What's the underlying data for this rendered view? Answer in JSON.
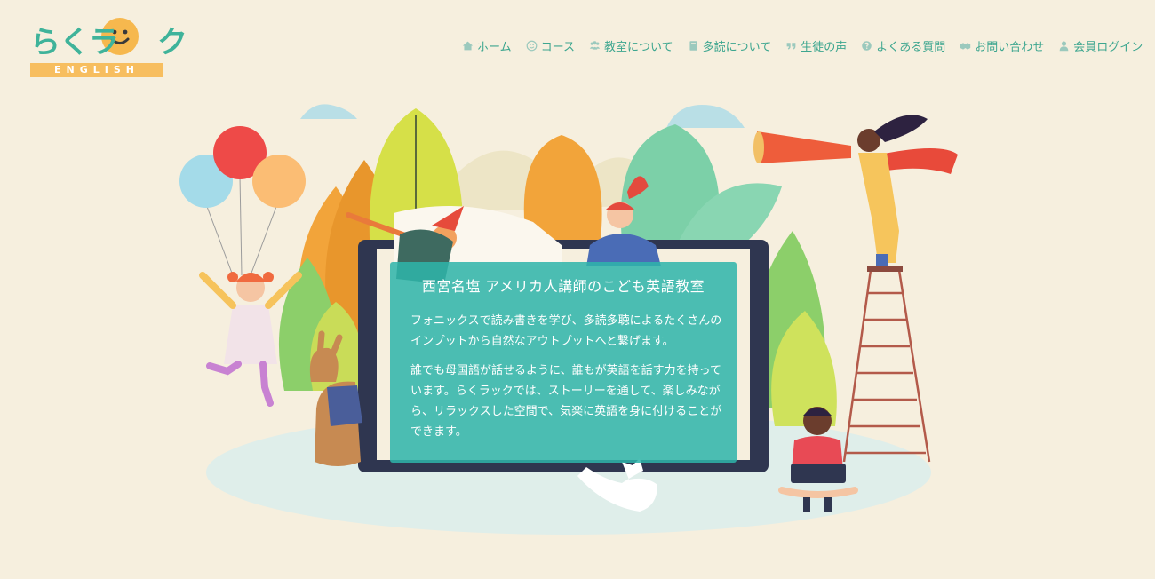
{
  "logo": {
    "text": "らくラ",
    "text_end": "ク",
    "sub": "ENGLISH"
  },
  "nav": {
    "items": [
      {
        "label": "ホーム",
        "icon": "home-icon",
        "active": true
      },
      {
        "label": "コース",
        "icon": "smile-icon"
      },
      {
        "label": "教室について",
        "icon": "people-icon"
      },
      {
        "label": "多読について",
        "icon": "book-icon"
      },
      {
        "label": "生徒の声",
        "icon": "quote-icon"
      },
      {
        "label": "よくある質問",
        "icon": "question-icon"
      },
      {
        "label": "お問い合わせ",
        "icon": "handshake-icon"
      },
      {
        "label": "会員ログイン",
        "icon": "user-icon"
      }
    ]
  },
  "hero": {
    "title": "西宮名塩 アメリカ人講師のこども英語教室",
    "paragraph1": "フォニックスで読み書きを学び、多読多聴によるたくさんのインプットから自然なアウトプットへと繋げます。",
    "paragraph2": "誰でも母国語が話せるように、誰もが英語を話す力を持っています。らくラックでは、ストーリーを通して、楽しみながら、リラックスした空間で、気楽に英語を身に付けることができます。"
  },
  "colors": {
    "background": "#f6efde",
    "accent": "#3fb39a",
    "panel": "#2fb4aa",
    "logo_yellow": "#f7be5f"
  }
}
